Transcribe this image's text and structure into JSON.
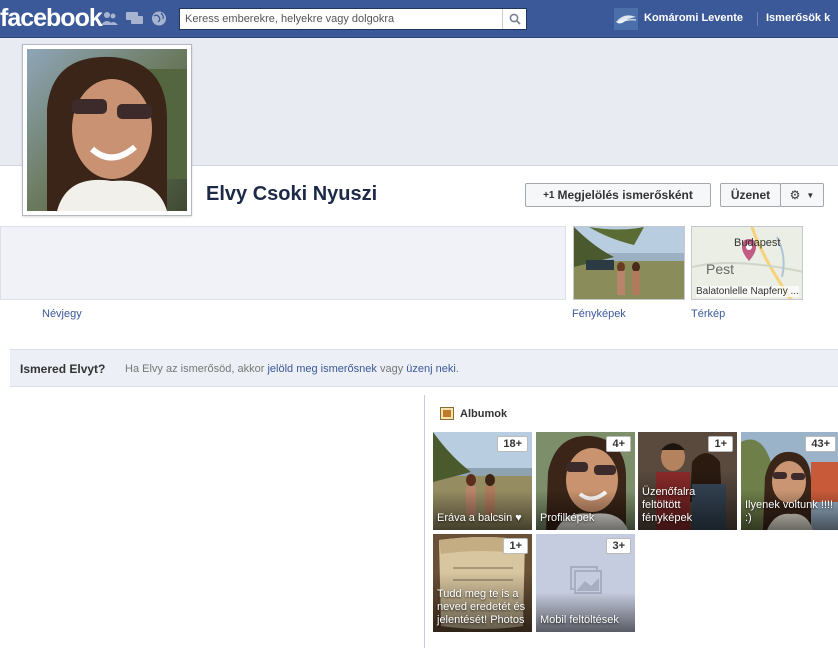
{
  "topbar": {
    "logo": "facebook",
    "search_placeholder": "Keress emberekre, helyekre vagy dolgokra",
    "user_name": "Komáromi Levente",
    "friends_link": "Ismerősök k"
  },
  "profile": {
    "name": "Elvy Csoki Nyuszi",
    "add_friend_label": "Megjelölés ismerősként",
    "message_label": "Üzenet"
  },
  "tabs": {
    "about": "Névjegy",
    "photos": "Fényképek",
    "map": "Térkép",
    "map_city": "Budapest",
    "map_region": "Pest",
    "map_place": "Balatonlelle Napfeny ..."
  },
  "know": {
    "question": "Ismered Elvyt?",
    "text_before": "Ha Elvy az ismerősöd, akkor",
    "link_mark": "jelöld meg ismerősnek",
    "text_mid": "vagy",
    "link_message": "üzenj neki",
    "text_end": "."
  },
  "albums": {
    "title": "Albumok",
    "items": [
      {
        "label": "Eráva a balcsin ♥",
        "count": "18+"
      },
      {
        "label": "Profilképek",
        "count": "4+"
      },
      {
        "label": "Üzenőfalra feltöltött fényképek",
        "count": "1+"
      },
      {
        "label": "Ilyenek voltunk !!!! :)",
        "count": "43+"
      },
      {
        "label": "Tudd meg te is a neved eredetét és jelentését! Photos",
        "count": "1+"
      },
      {
        "label": "Mobil feltöltések",
        "count": "3+"
      }
    ]
  },
  "colors": {
    "brand": "#3b5998",
    "link": "#3b5998"
  }
}
